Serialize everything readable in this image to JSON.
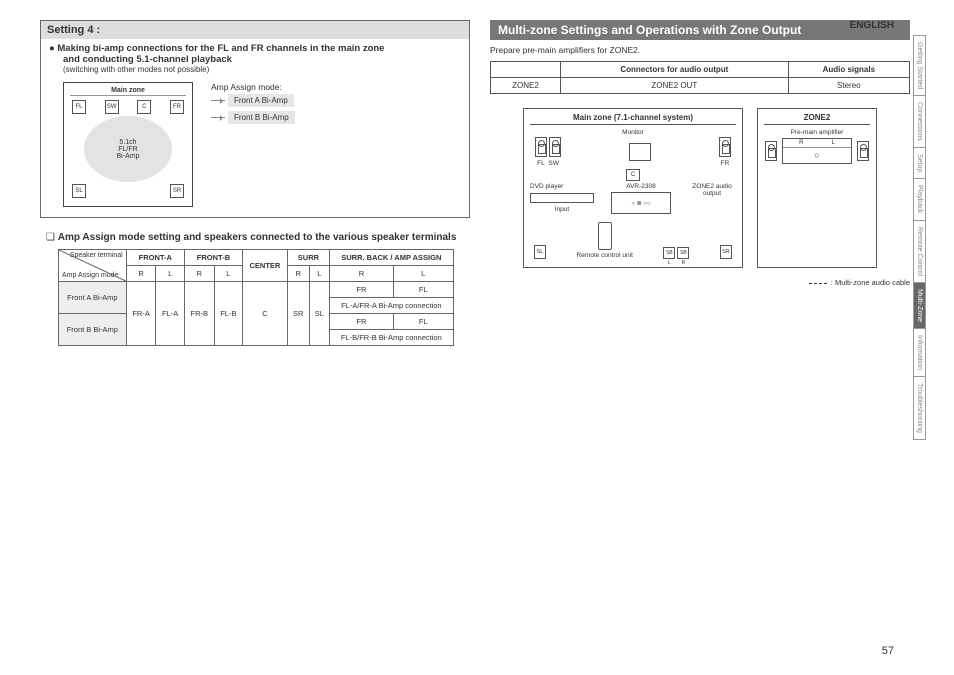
{
  "header": {
    "language": "ENGLISH",
    "page_number": "57"
  },
  "tabs": {
    "t0": "Getting Started",
    "t1": "Connections",
    "t2": "Setup",
    "t3": "Playback",
    "t4": "Remote Control",
    "t5": "Multi-Zone",
    "t6": "Information",
    "t7": "Troubleshooting"
  },
  "left": {
    "title": "Setting 4 :",
    "bullet1": "Making bi-amp connections for the FL and FR channels in the main zone",
    "bullet2": "and conducting 5.1-channel playback",
    "bullet_note": "(switching with other modes not possible)",
    "mainzone_title": "Main zone",
    "mainzone_circle_l1": "5.1ch",
    "mainzone_circle_l2": "FL/FR",
    "mainzone_circle_l3": "Bi-Amp",
    "sp": {
      "fl": "FL",
      "sw": "SW",
      "c": "C",
      "fr": "FR",
      "sl": "SL",
      "sr": "SR"
    },
    "amp_label": "Amp Assign mode:",
    "mode_a": "Front A Bi-Amp",
    "mode_b": "Front B Bi-Amp",
    "subhead": "Amp Assign mode setting and speakers connected to the various speaker terminals",
    "table": {
      "hdr_sp_term": "Speaker terminal",
      "hdr_amp": "Amp Assign mode",
      "cols": {
        "fa": "FRONT-A",
        "fb": "FRONT-B",
        "c": "CENTER",
        "surr": "SURR",
        "sb": "SURR. BACK / AMP ASSIGN"
      },
      "sub": {
        "r": "R",
        "l": "L"
      },
      "rows": {
        "r1": "Front A Bi-Amp",
        "r2": "Front B Bi-Amp"
      },
      "cells": {
        "fra": "FR-A",
        "fla": "FL-A",
        "frb": "FR-B",
        "flb": "FL-B",
        "c": "C",
        "sr": "SR",
        "sl": "SL",
        "sb1_fr": "FR",
        "sb1_fl": "FL",
        "sb1_label": "FL-A/FR-A Bi-Amp connection",
        "sb2_fr": "FR",
        "sb2_fl": "FL",
        "sb2_label": "FL-B/FR-B Bi-Amp connection"
      }
    }
  },
  "right": {
    "bar": "Multi-zone Settings and Operations with Zone Output",
    "prep": "Prepare pre-main amplifiers for ZONE2.",
    "conn": {
      "h1": "Connectors for audio output",
      "h2": "Audio signals",
      "z2": "ZONE2",
      "out": "ZONE2 OUT",
      "sig": "Stereo"
    },
    "sys": {
      "mz": "Main zone (7.1-channel system)",
      "z2": "ZONE2",
      "monitor": "Monitor",
      "fl": "FL",
      "sw": "SW",
      "c": "C",
      "fr": "FR",
      "sl": "SL",
      "sr": "SR",
      "sbl": "SB L",
      "sbr": "SB R",
      "dvd": "DVD player",
      "avr": "AVR-2308",
      "input": "Input",
      "remote": "Remote control unit",
      "z2out": "ZONE2 audio output",
      "preamp": "Pre-main amplifier",
      "cable": ": Multi-zone audio cable"
    }
  }
}
